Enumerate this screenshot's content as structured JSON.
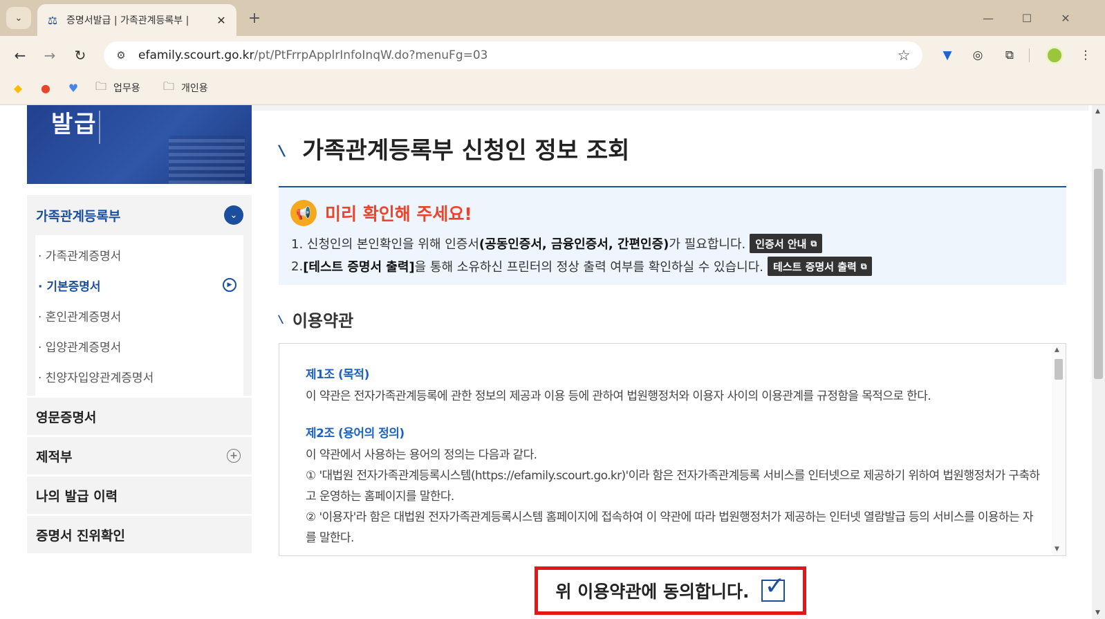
{
  "browser": {
    "tab": {
      "title": "증명서발급 | 가족관계등록부 |",
      "favicon": "court-seal-icon"
    },
    "url_host": "efamily.scourt.go.kr",
    "url_path": "/pt/PtFrrpApplrInfoInqW.do?menuFg=03",
    "bookmarks": [
      {
        "label": "업무용",
        "icon": "folder-icon"
      },
      {
        "label": "개인용",
        "icon": "folder-icon"
      }
    ]
  },
  "banner": {
    "text": "발급"
  },
  "sidebar": {
    "section_title": "가족관계등록부",
    "sub_items": [
      {
        "label": "· 가족관계증명서"
      },
      {
        "label": "· 기본증명서"
      },
      {
        "label": "· 혼인관계증명서"
      },
      {
        "label": "· 입양관계증명서"
      },
      {
        "label": "· 친양자입양관계증명서"
      }
    ],
    "active_item": "· 기본증명서",
    "menus": [
      {
        "label": "영문증명서"
      },
      {
        "label": "제적부"
      },
      {
        "label": "나의 발급 이력"
      },
      {
        "label": "증명서 진위확인"
      }
    ]
  },
  "main": {
    "title": "가족관계등록부 신청인 정보 조회",
    "notice": {
      "title": "미리 확인해 주세요!",
      "line1_pre": "1. 신청인의 본인확인을 위해 인증서",
      "line1_bold": "(공동인증서, 금융인증서, 간편인증)",
      "line1_post": "가 필요합니다.",
      "line1_button": "인증서 안내",
      "line2_pre": "2. ",
      "line2_bold": "[테스트 증명서 출력]",
      "line2_post": "을 통해 소유하신 프린터의 정상 출력 여부를 확인하실 수 있습니다.",
      "line2_button": "테스트 증명서 출력"
    },
    "terms": {
      "title": "이용약관",
      "art1_title": "제1조 (목적)",
      "art1_text": "이 약관은 전자가족관계등록에 관한 정보의 제공과 이용 등에 관하여 법원행정처와 이용자 사이의 이용관계를 규정함을 목적으로 한다.",
      "art2_title": "제2조 (용어의 정의)",
      "art2_text1": "이 약관에서 사용하는 용어의 정의는 다음과 같다.",
      "art2_text2": "① '대법원 전자가족관계등록시스템(https://efamily.scourt.go.kr)'이라 함은 전자가족관계등록 서비스를 인터넷으로 제공하기 위하여 법원행정처가 구축하고 운영하는 홈페이지를 말한다.",
      "art2_text3": "② '이용자'라 함은 대법원 전자가족관계등록시스템 홈페이지에 접속하여 이 약관에 따라 법원행정처가 제공하는 인터넷 열람발급 등의 서비스를 이용하는 자를 말한다."
    },
    "agree_label": "위 이용약관에 동의합니다.",
    "agree_checked": true
  },
  "colors": {
    "accent": "#1b4f9e",
    "notice_title": "#e8462c",
    "highlight_border": "#e01818"
  }
}
